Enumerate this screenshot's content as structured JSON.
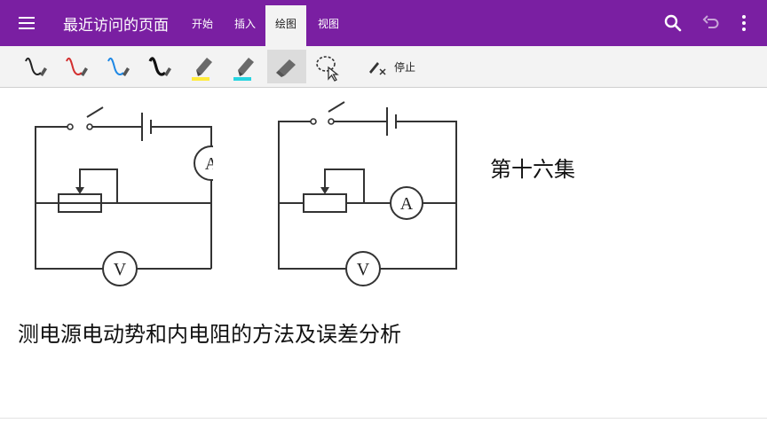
{
  "header": {
    "page_title": "最近访问的页面",
    "tabs": [
      {
        "label": "开始",
        "active": false
      },
      {
        "label": "插入",
        "active": false
      },
      {
        "label": "绘图",
        "active": true
      },
      {
        "label": "视图",
        "active": false
      }
    ],
    "background_color": "#7a1fa2"
  },
  "draw_toolbar": {
    "pens": [
      {
        "name": "pen-black-thin",
        "color": "#222222"
      },
      {
        "name": "pen-red",
        "color": "#d32f2f"
      },
      {
        "name": "pen-blue",
        "color": "#1e88e5"
      },
      {
        "name": "pen-black-thick",
        "color": "#111111"
      }
    ],
    "highlighters": [
      {
        "name": "highlighter-yellow",
        "color": "#ffeb3b"
      },
      {
        "name": "highlighter-cyan",
        "color": "#26d4e0"
      }
    ],
    "eraser_active": true,
    "stop_label": "停止"
  },
  "canvas": {
    "episode_label": "第十六集",
    "topic_title": "测电源电动势和内电阻的方法及误差分析",
    "circuit_labels": {
      "ammeter": "A",
      "voltmeter": "V"
    }
  }
}
